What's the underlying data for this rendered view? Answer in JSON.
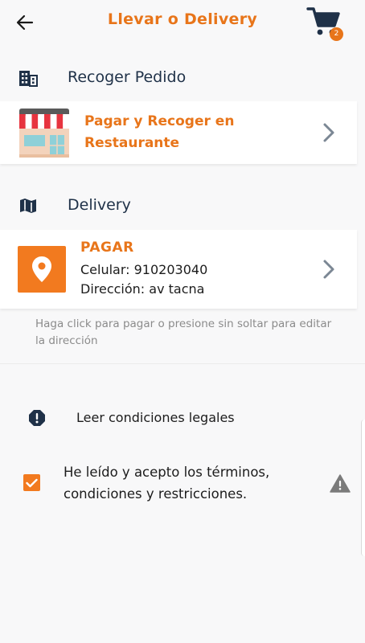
{
  "header": {
    "title": "Llevar o Delivery",
    "cart_count": "2",
    "back_icon": "arrow-left-icon",
    "cart_icon": "shopping-cart-icon"
  },
  "pickup": {
    "heading": "Recoger Pedido",
    "icon": "building-icon",
    "card": {
      "title": "Pagar y Recoger en Restaurante",
      "image": "storefront-icon"
    }
  },
  "delivery": {
    "heading": "Delivery",
    "icon": "map-icon",
    "card": {
      "title": "PAGAR",
      "phone": "Celular: 910203040",
      "address": "Dirección: av tacna",
      "icon": "location-pin-icon"
    },
    "hint": "Haga click para pagar o presione sin soltar para editar la dirección"
  },
  "legal": {
    "link_text": "Leer condiciones legales",
    "icon": "alert-circle-icon"
  },
  "terms": {
    "text": "He leído y acepto los términos, condiciones y restricciones.",
    "checked": true,
    "warning_icon": "warning-triangle-icon"
  },
  "colors": {
    "accent": "#e8751a",
    "heading_text": "#1f3148",
    "background": "#f8f8f9"
  }
}
